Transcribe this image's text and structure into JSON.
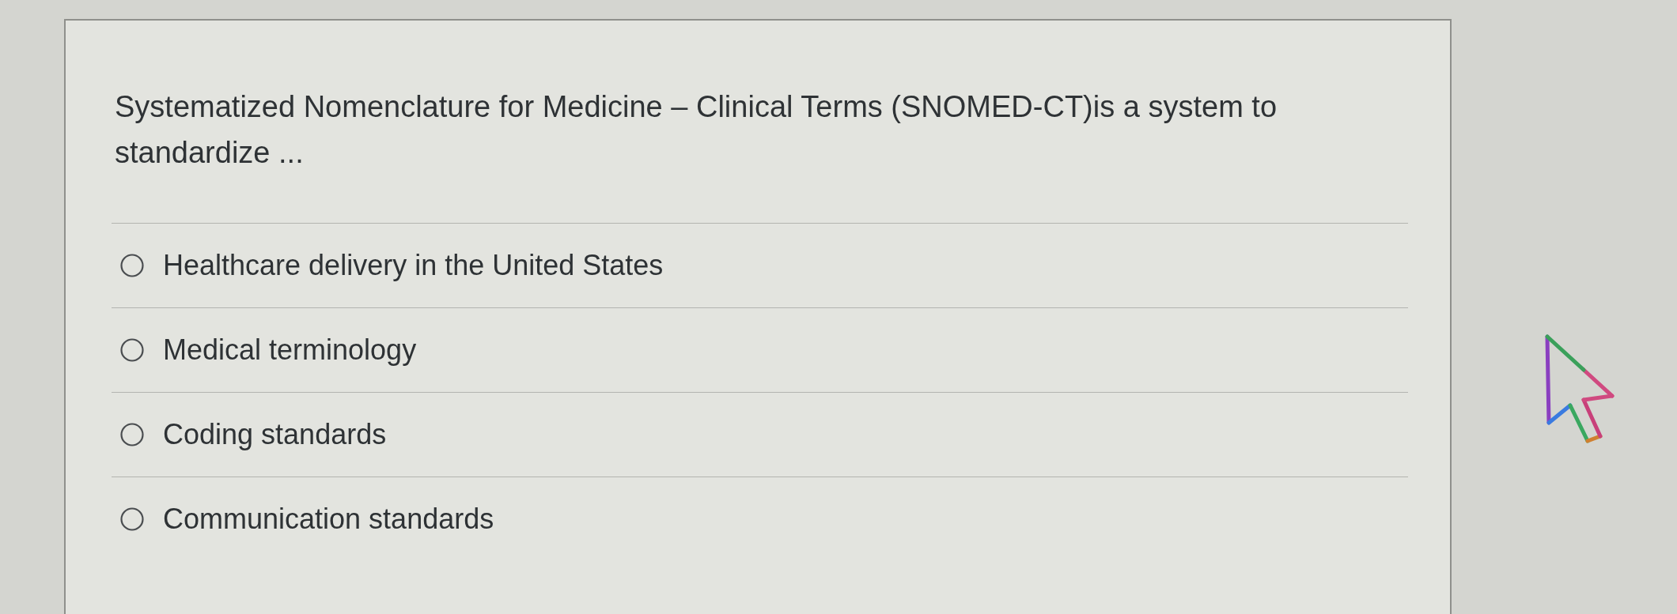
{
  "question": {
    "text": "Systematized Nomenclature for Medicine – Clinical Terms (SNOMED-CT)is a system to standardize ...",
    "options": [
      {
        "label": "Healthcare delivery in the United States",
        "selected": false
      },
      {
        "label": "Medical terminology",
        "selected": false
      },
      {
        "label": "Coding standards",
        "selected": false
      },
      {
        "label": "Communication standards",
        "selected": false
      }
    ]
  }
}
